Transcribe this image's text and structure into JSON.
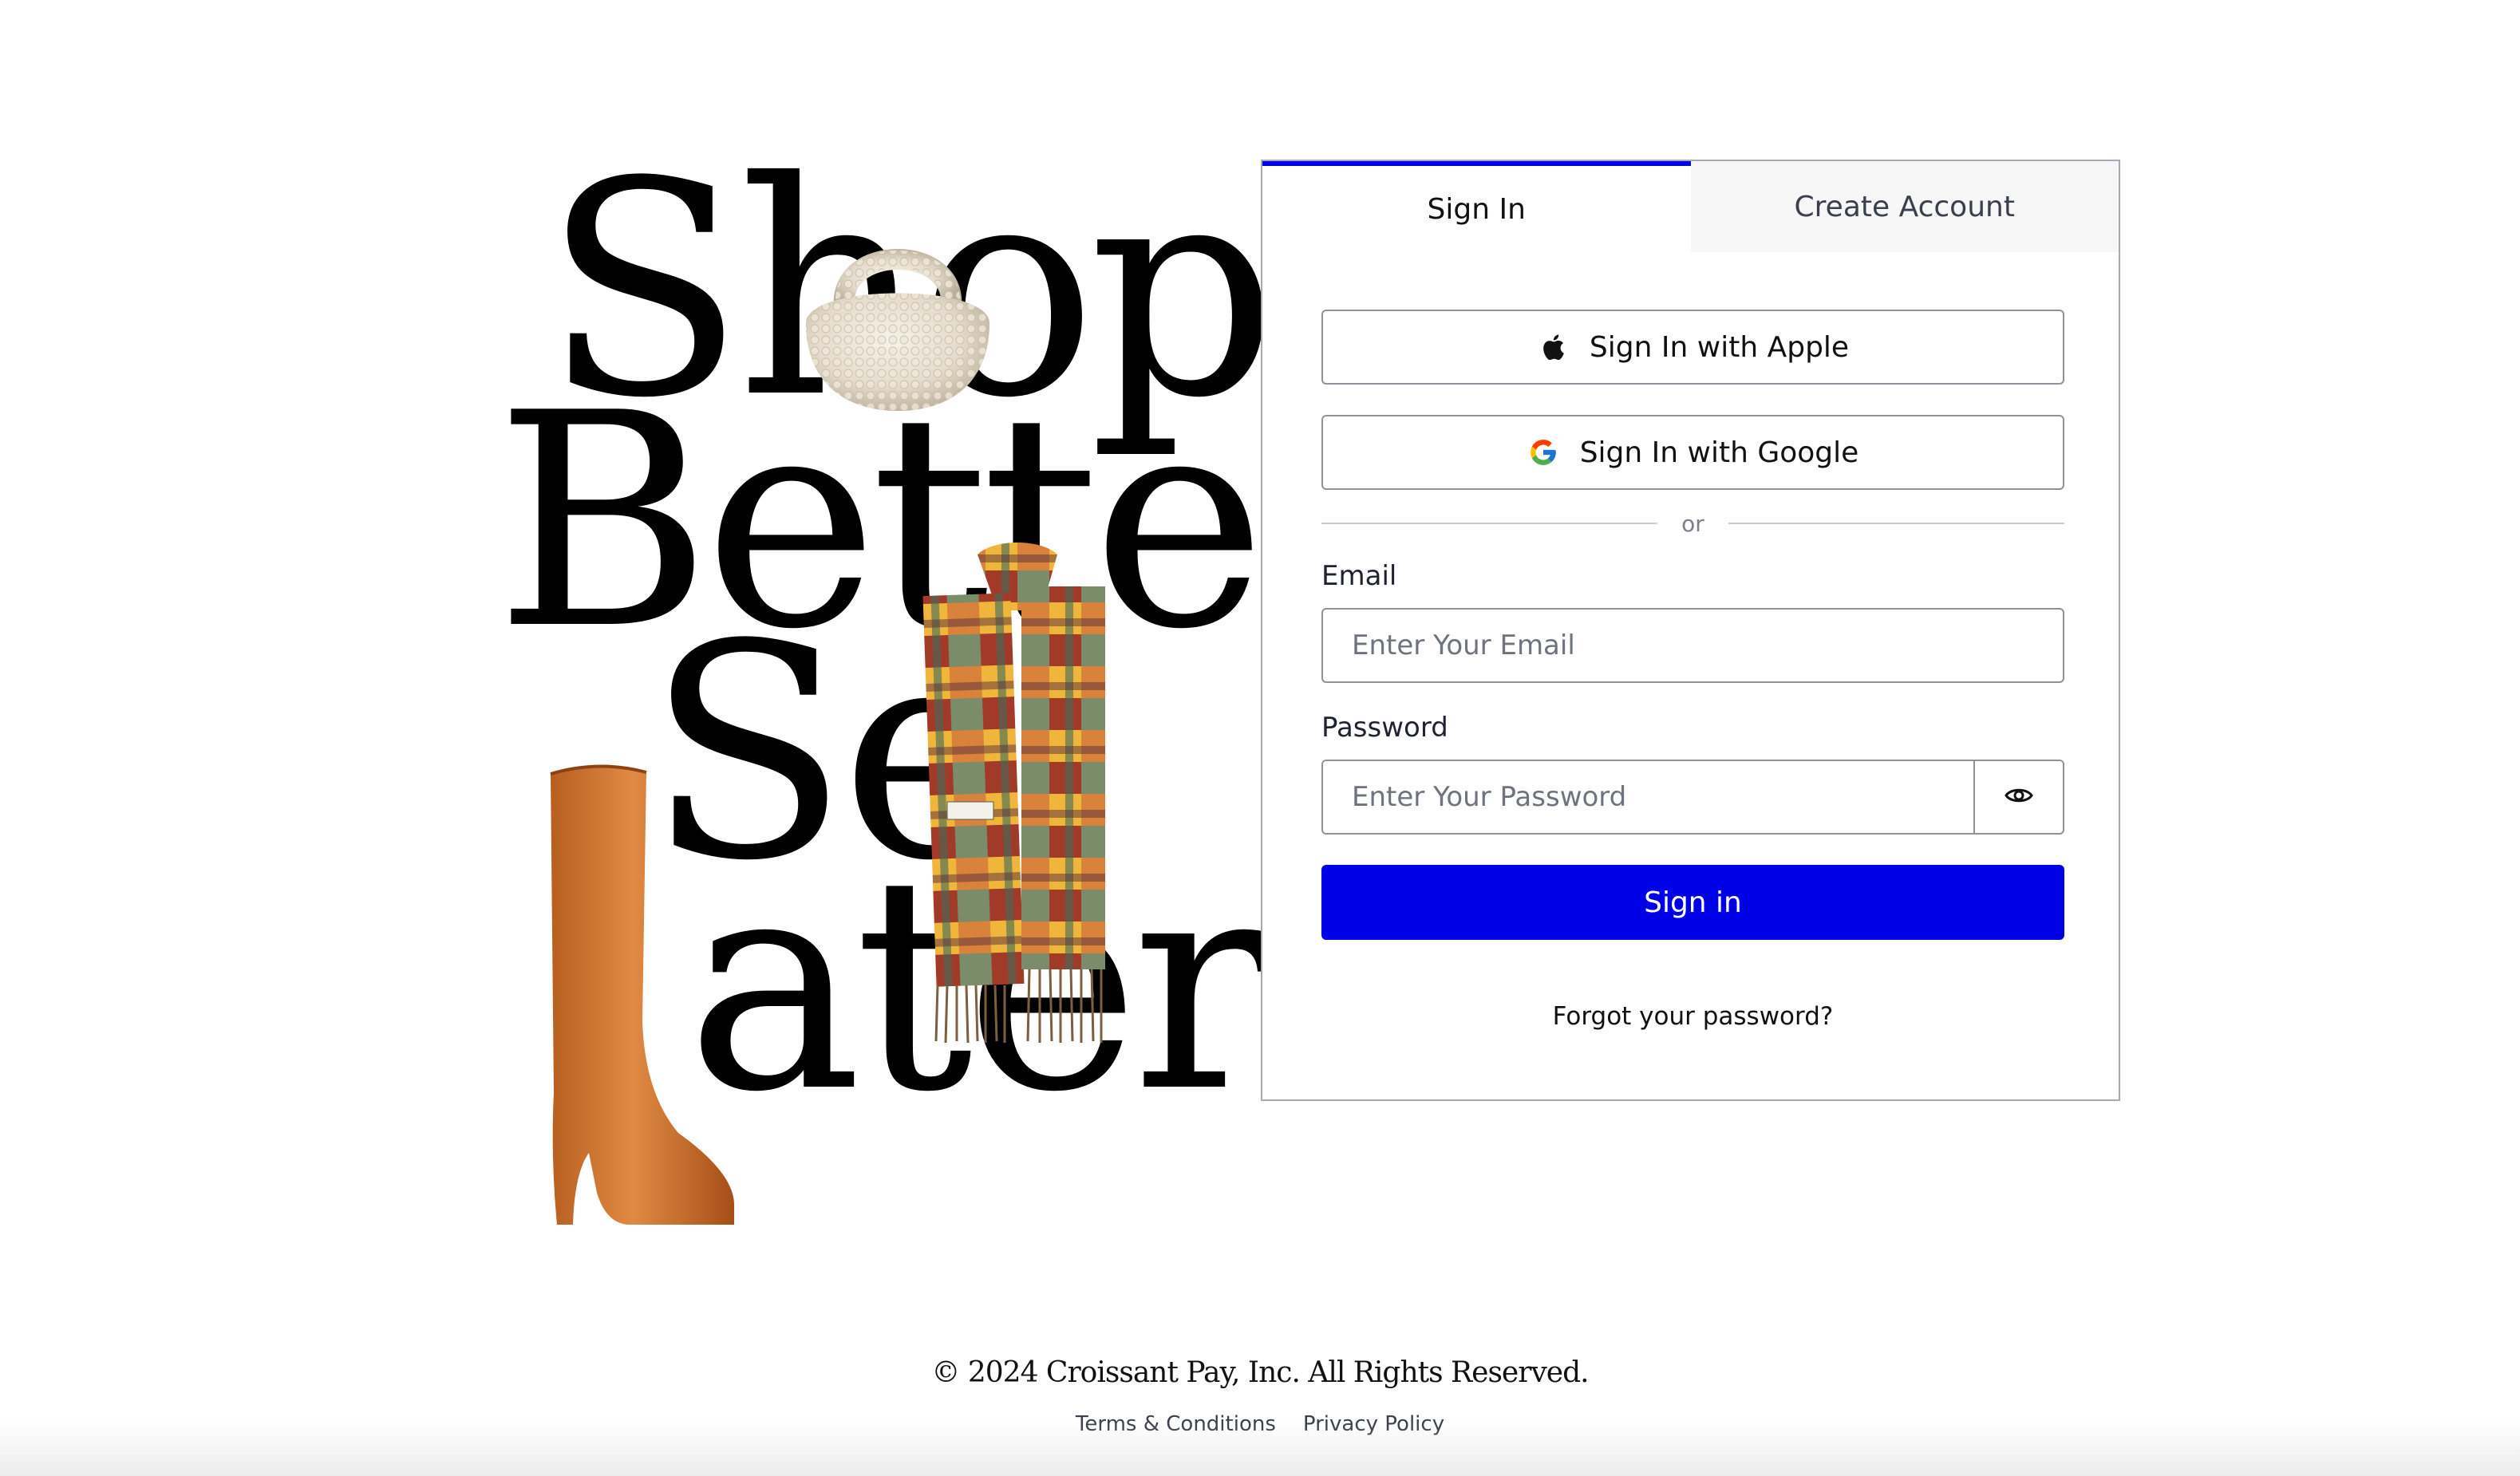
{
  "hero": {
    "lines": [
      "Shop",
      "Better",
      "Se",
      "ater"
    ],
    "images": {
      "bag": "beaded-handbag-image",
      "scarf": "plaid-scarf-image",
      "boot": "tan-leather-boot-image"
    }
  },
  "tabs": [
    {
      "label": "Sign In",
      "active": true
    },
    {
      "label": "Create Account",
      "active": false
    }
  ],
  "social": {
    "apple_label": "Sign In with Apple",
    "google_label": "Sign In with Google",
    "divider_text": "or"
  },
  "email": {
    "label": "Email",
    "placeholder": "Enter Your Email",
    "value": ""
  },
  "password": {
    "label": "Password",
    "placeholder": "Enter Your Password",
    "value": ""
  },
  "submit_label": "Sign in",
  "forgot_label": "Forgot your password?",
  "footer": {
    "copyright": "© 2024 Croissant Pay, Inc. All Rights Reserved.",
    "links": [
      "Terms & Conditions",
      "Privacy Policy"
    ]
  },
  "colors": {
    "accent": "#0000e6",
    "border": "#8c919b",
    "inactive_tab_bg": "#f6f6f7"
  },
  "icons": {
    "apple": "apple-icon",
    "google": "google-icon",
    "eye": "eye-icon"
  }
}
